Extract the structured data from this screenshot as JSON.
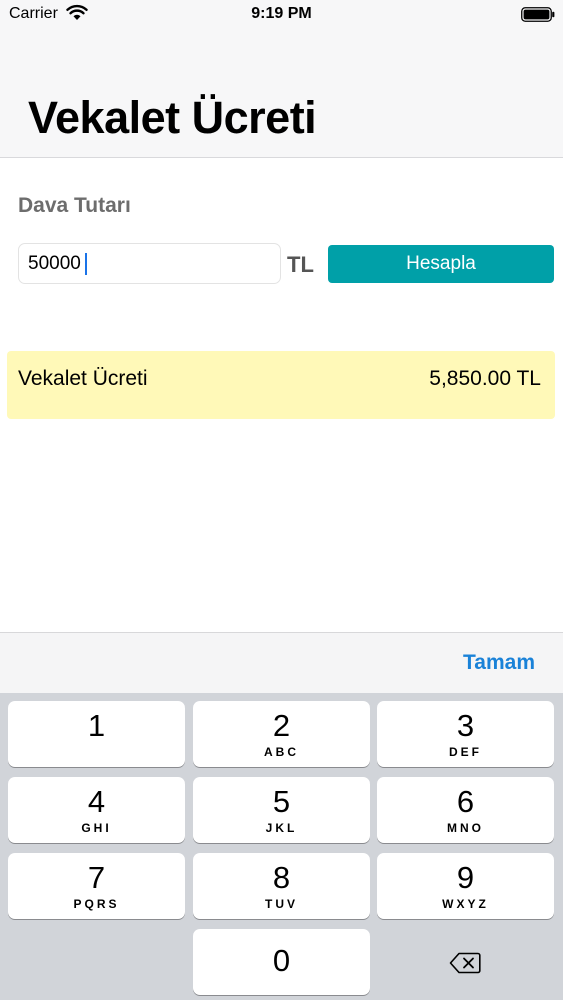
{
  "status_bar": {
    "carrier": "Carrier",
    "time": "9:19 PM"
  },
  "nav": {
    "title": "Vekalet Ücreti"
  },
  "form": {
    "section_label": "Dava Tutarı",
    "amount_value": "50000",
    "currency": "TL",
    "calculate_label": "Hesapla"
  },
  "result": {
    "label": "Vekalet Ücreti",
    "value": "5,850.00 TL"
  },
  "accessory": {
    "done_label": "Tamam"
  },
  "keypad": {
    "keys": [
      {
        "digit": "1",
        "letters": ""
      },
      {
        "digit": "2",
        "letters": "ABC"
      },
      {
        "digit": "3",
        "letters": "DEF"
      },
      {
        "digit": "4",
        "letters": "GHI"
      },
      {
        "digit": "5",
        "letters": "JKL"
      },
      {
        "digit": "6",
        "letters": "MNO"
      },
      {
        "digit": "7",
        "letters": "PQRS"
      },
      {
        "digit": "8",
        "letters": "TUV"
      },
      {
        "digit": "9",
        "letters": "WXYZ"
      },
      {
        "digit": "0",
        "letters": ""
      }
    ],
    "delete_icon": "backspace-icon"
  },
  "colors": {
    "accent_button": "#00a0a8",
    "done_blue": "#1a82d8",
    "result_bg": "#fff9b8"
  }
}
